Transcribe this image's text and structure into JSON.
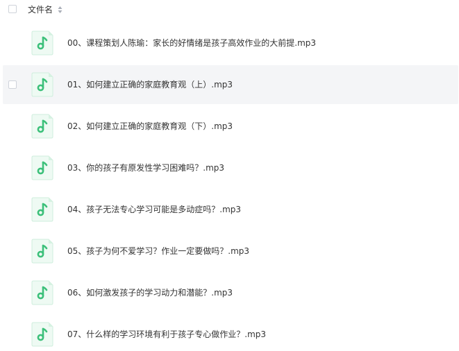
{
  "header": {
    "column_label": "文件名"
  },
  "icons": {
    "file_type": "audio-file-icon",
    "sort": "sort-icon",
    "accent_color": "#3cc07a",
    "accent_bg": "#eefaf3"
  },
  "files": [
    {
      "name": "00、课程策划人陈瑜：家长的好情绪是孩子高效作业的大前提.mp3",
      "hover": false
    },
    {
      "name": "01、如何建立正确的家庭教育观（上）.mp3",
      "hover": true
    },
    {
      "name": "02、如何建立正确的家庭教育观（下）.mp3",
      "hover": false
    },
    {
      "name": "03、你的孩子有原发性学习困难吗？.mp3",
      "hover": false
    },
    {
      "name": "04、孩子无法专心学习可能是多动症吗？.mp3",
      "hover": false
    },
    {
      "name": "05、孩子为何不爱学习？作业一定要做吗？.mp3",
      "hover": false
    },
    {
      "name": "06、如何激发孩子的学习动力和潜能？.mp3",
      "hover": false
    },
    {
      "name": "07、什么样的学习环境有利于孩子专心做作业？.mp3",
      "hover": false
    }
  ]
}
